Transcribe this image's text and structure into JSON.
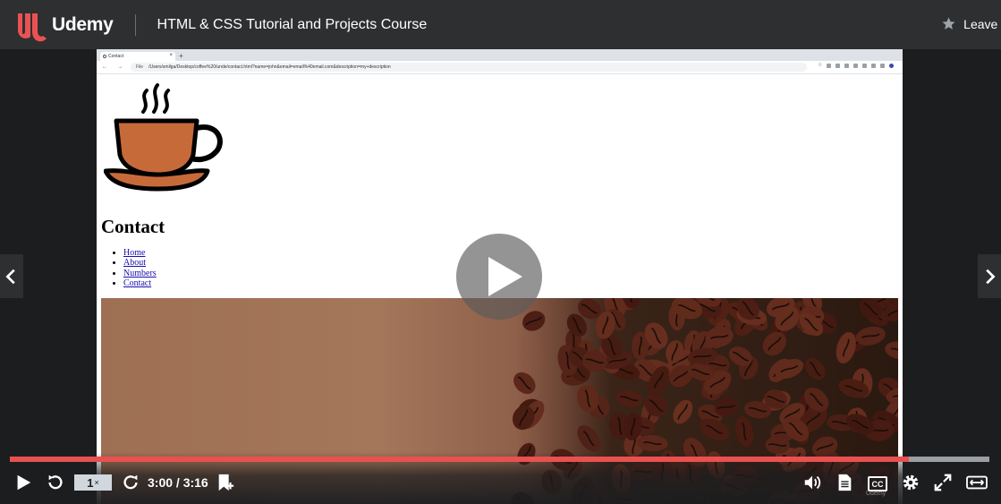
{
  "brand": {
    "name": "Udemy",
    "color": "#a435f0",
    "logo_color": "#ea5252"
  },
  "header": {
    "course_title": "HTML & CSS Tutorial and Projects Course",
    "rating_label": "Leave a"
  },
  "recording": {
    "browser": {
      "tab_title": "Contact",
      "new_tab": "+",
      "url_prefix": "File",
      "url": "/Users/smilga/Desktop/coffee%20/unde/contact.html?name=john&email=email%40email.com&description=my+description"
    },
    "page": {
      "heading": "Contact",
      "nav_links": [
        "Home",
        "About",
        "Numbers",
        "Contact"
      ]
    }
  },
  "player": {
    "speed": "1",
    "speed_suffix": "×",
    "current_time": "3:00",
    "duration": "3:16",
    "time_display": "3:00 / 3:16",
    "progress_fraction": 0.918,
    "cc_label": "CC",
    "watermark": "Udemy",
    "progress_color": "#e8514f"
  },
  "icons": [
    "star-icon",
    "play-icon",
    "rewind-icon",
    "forward-icon",
    "bookmark-add-icon",
    "volume-icon",
    "transcript-icon",
    "settings-icon",
    "fullscreen-icon",
    "expand-icon",
    "chevron-left-icon",
    "chevron-right-icon",
    "coffee-cup-icon"
  ]
}
